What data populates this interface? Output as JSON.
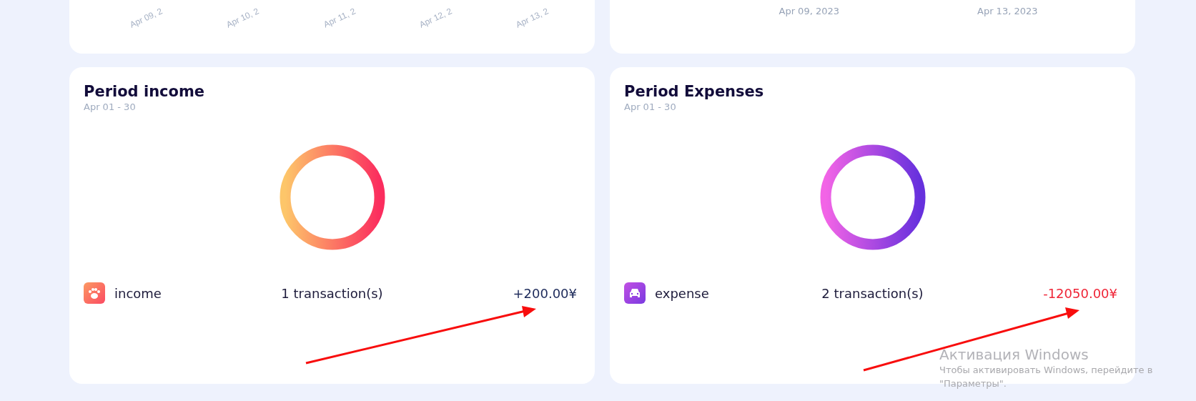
{
  "top_cards": [
    {
      "kind": "rotated",
      "labels": [
        "Apr 09, 2",
        "Apr 10, 2",
        "Apr 11, 2",
        "Apr 12, 2",
        "Apr 13, 2"
      ]
    },
    {
      "kind": "flat",
      "labels": [
        "Apr 09, 2023",
        "Apr 13, 2023"
      ]
    }
  ],
  "cards": [
    {
      "title": "Period income",
      "subtitle": "Apr 01 - 30",
      "kind": "income",
      "category": "income",
      "count": "1 transaction(s)",
      "amount": "+200.00¥"
    },
    {
      "title": "Period Expenses",
      "subtitle": "Apr 01 - 30",
      "kind": "expense",
      "category": "expense",
      "count": "2 transaction(s)",
      "amount": "-12050.00¥"
    }
  ],
  "activation": {
    "title": "Активация Windows",
    "lines": [
      "Чтобы активировать Windows, перейдите в",
      "\"Параметры\"."
    ]
  }
}
